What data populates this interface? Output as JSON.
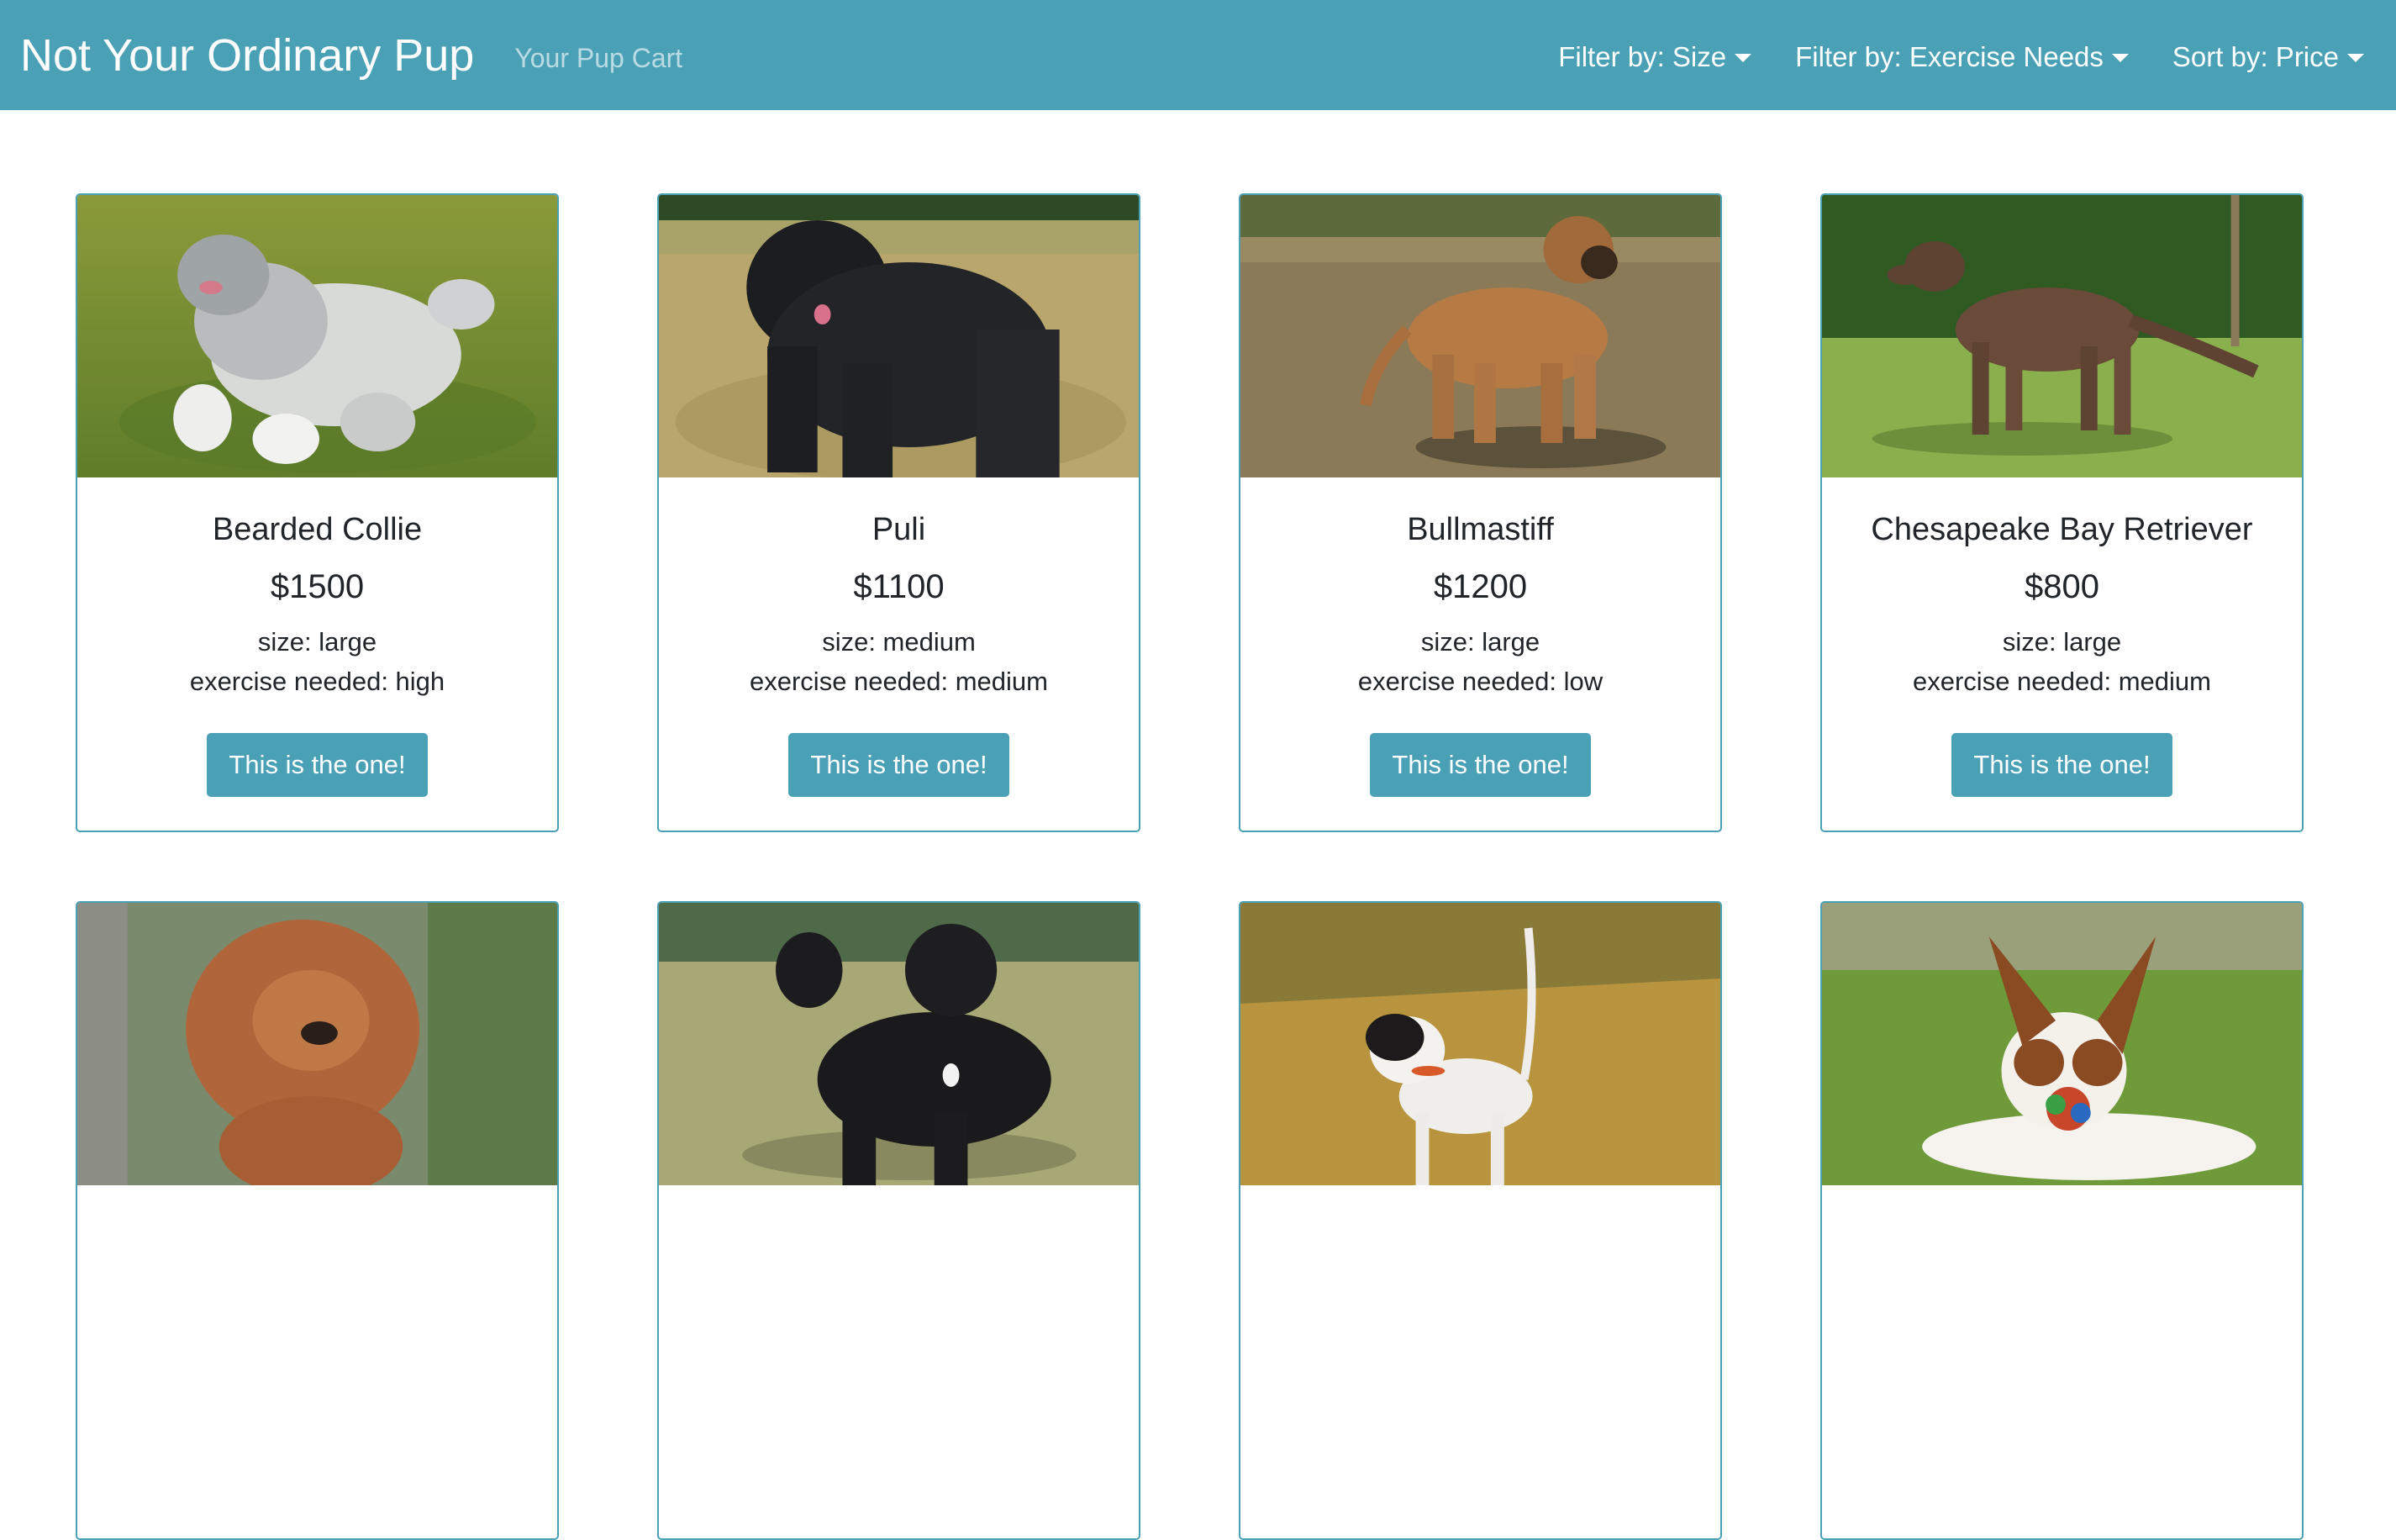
{
  "navbar": {
    "brand": "Not Your Ordinary Pup",
    "cart_link": "Your Pup Cart",
    "filter_size": "Filter by: Size",
    "filter_exercise": "Filter by: Exercise Needs",
    "sort_price": "Sort by: Price"
  },
  "labels": {
    "size_prefix": "size: ",
    "exercise_prefix": "exercise needed: ",
    "button": "This is the one!"
  },
  "colors": {
    "accent": "#4aa1b6",
    "text": "#212529"
  },
  "pups": [
    {
      "name": "Bearded Collie",
      "price": "$1500",
      "size": "size: large",
      "exercise": "exercise needed: high",
      "photo": "bearded-collie-photo"
    },
    {
      "name": "Puli",
      "price": "$1100",
      "size": "size: medium",
      "exercise": "exercise needed: medium",
      "photo": "puli-photo"
    },
    {
      "name": "Bullmastiff",
      "price": "$1200",
      "size": "size: large",
      "exercise": "exercise needed: low",
      "photo": "bullmastiff-photo"
    },
    {
      "name": "Chesapeake Bay Retriever",
      "price": "$800",
      "size": "size: large",
      "exercise": "exercise needed: medium",
      "photo": "chesapeake-bay-retriever-photo"
    },
    {
      "photo": "chow-chow-photo"
    },
    {
      "photo": "portuguese-water-dog-photo"
    },
    {
      "photo": "pointer-photo"
    },
    {
      "photo": "papillon-photo"
    }
  ]
}
